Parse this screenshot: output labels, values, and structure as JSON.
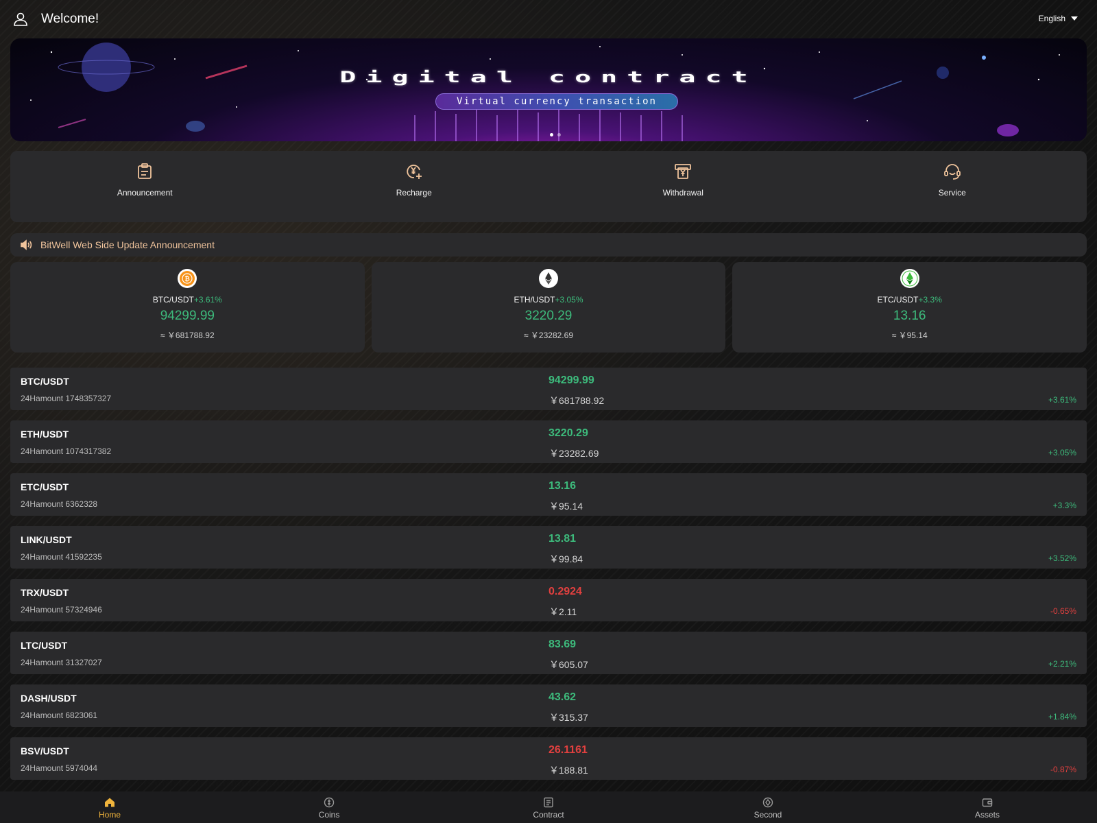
{
  "header": {
    "welcome": "Welcome!",
    "language": "English"
  },
  "banner": {
    "title": "Digital contract",
    "subtitle": "Virtual currency transaction"
  },
  "quick_actions": [
    {
      "label": "Announcement",
      "icon": "clipboard-icon"
    },
    {
      "label": "Recharge",
      "icon": "yen-coin-plus-icon"
    },
    {
      "label": "Withdrawal",
      "icon": "yen-withdraw-icon"
    },
    {
      "label": "Service",
      "icon": "headset-icon"
    }
  ],
  "notice": {
    "text": "BitWell Web Side Update Announcement"
  },
  "featured": [
    {
      "pair": "BTC/USDT",
      "change": "+3.61%",
      "price": "94299.99",
      "cny": "≈ ￥681788.92",
      "icon": "bitcoin-icon"
    },
    {
      "pair": "ETH/USDT",
      "change": "+3.05%",
      "price": "3220.29",
      "cny": "≈ ￥23282.69",
      "icon": "ethereum-icon"
    },
    {
      "pair": "ETC/USDT",
      "change": "+3.3%",
      "price": "13.16",
      "cny": "≈ ￥95.14",
      "icon": "ethereum-classic-icon"
    }
  ],
  "markets": [
    {
      "pair": "BTC/USDT",
      "volume": "24Hamount 1748357327",
      "price": "94299.99",
      "cny": "￥681788.92",
      "change": "+3.61%",
      "direction": "up"
    },
    {
      "pair": "ETH/USDT",
      "volume": "24Hamount 1074317382",
      "price": "3220.29",
      "cny": "￥23282.69",
      "change": "+3.05%",
      "direction": "up"
    },
    {
      "pair": "ETC/USDT",
      "volume": "24Hamount 6362328",
      "price": "13.16",
      "cny": "￥95.14",
      "change": "+3.3%",
      "direction": "up"
    },
    {
      "pair": "LINK/USDT",
      "volume": "24Hamount 41592235",
      "price": "13.81",
      "cny": "￥99.84",
      "change": "+3.52%",
      "direction": "up"
    },
    {
      "pair": "TRX/USDT",
      "volume": "24Hamount 57324946",
      "price": "0.2924",
      "cny": "￥2.11",
      "change": "-0.65%",
      "direction": "down"
    },
    {
      "pair": "LTC/USDT",
      "volume": "24Hamount 31327027",
      "price": "83.69",
      "cny": "￥605.07",
      "change": "+2.21%",
      "direction": "up"
    },
    {
      "pair": "DASH/USDT",
      "volume": "24Hamount 6823061",
      "price": "43.62",
      "cny": "￥315.37",
      "change": "+1.84%",
      "direction": "up"
    },
    {
      "pair": "BSV/USDT",
      "volume": "24Hamount 5974044",
      "price": "26.1161",
      "cny": "￥188.81",
      "change": "-0.87%",
      "direction": "down"
    }
  ],
  "tabbar": [
    {
      "label": "Home",
      "icon": "home-icon",
      "active": true
    },
    {
      "label": "Coins",
      "icon": "coin-icon",
      "active": false
    },
    {
      "label": "Contract",
      "icon": "document-icon",
      "active": false
    },
    {
      "label": "Second",
      "icon": "compass-icon",
      "active": false
    },
    {
      "label": "Assets",
      "icon": "wallet-icon",
      "active": false
    }
  ],
  "colors": {
    "up": "#3dbb7c",
    "down": "#e2403f",
    "accent": "#f0b43c",
    "panel": "#2a2a2c",
    "notice_text": "#f0c49c"
  }
}
